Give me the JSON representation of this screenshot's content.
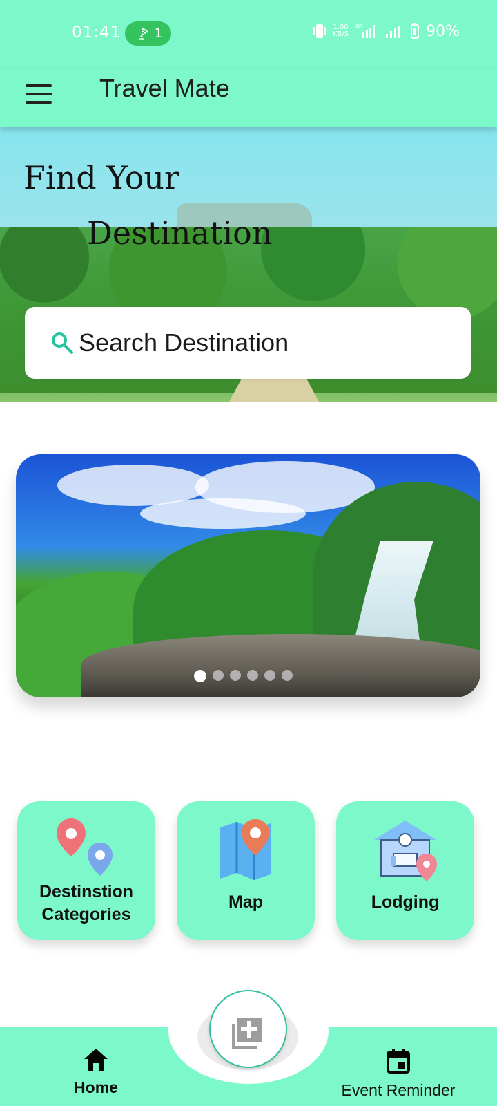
{
  "status_bar": {
    "time": "01:41",
    "hotspot_count": "1",
    "network_speed": "1.00",
    "network_unit": "KB/S",
    "network_type": "4G",
    "battery": "90%"
  },
  "app_bar": {
    "title": "Travel Mate",
    "menu_icon": "menu-icon"
  },
  "hero": {
    "line1": "Find Your",
    "line2": "Destination",
    "search_placeholder": "Search Destination"
  },
  "carousel": {
    "active_index": 1,
    "dot_count": 6
  },
  "features": [
    {
      "label_line1": "Destinstion",
      "label_line2": "Categories",
      "icon": "map-pins-icon"
    },
    {
      "label_line1": "Map",
      "label_line2": "",
      "icon": "map-icon"
    },
    {
      "label_line1": "Lodging",
      "label_line2": "",
      "icon": "lodging-icon"
    }
  ],
  "bottom_nav": {
    "home_label": "Home",
    "event_label": "Event Reminder",
    "home_icon": "home-icon",
    "event_icon": "calendar-icon",
    "fab_icon": "add-layers-icon"
  },
  "colors": {
    "accent": "#7df8cb",
    "status_pill": "#34c35f",
    "search_icon": "#24c59a"
  }
}
